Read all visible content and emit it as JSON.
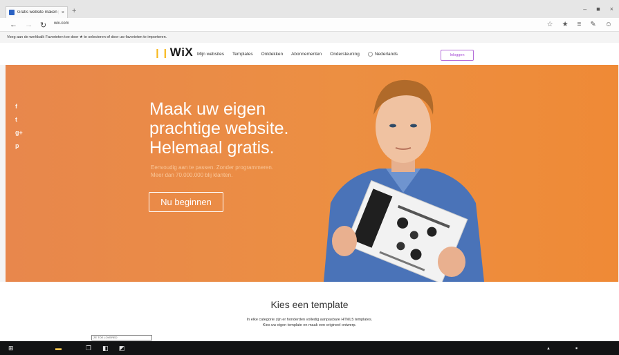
{
  "browser": {
    "tab_title": "Gratis website maken | W",
    "tab_close": "×",
    "new_tab": "+",
    "window_controls": [
      "–",
      "■",
      "×"
    ],
    "back": "←",
    "forward": "→",
    "refresh": "↻",
    "url": "wix.com",
    "right_icons": [
      "☆",
      "★",
      "≡",
      "✎",
      "☺"
    ],
    "favorites_hint": "Voeg aan de werkbalk Favorieten toe door ★ te selecteren of door uw favorieten te importeren."
  },
  "header": {
    "logo": "WiX",
    "logo_mark": "❙❙",
    "nav": [
      "Mijn websites",
      "Templates",
      "Ontdekken",
      "Abonnementen",
      "Ondersteuning"
    ],
    "language": "Nederlands",
    "login": "Inloggen"
  },
  "hero": {
    "social": [
      "f",
      "t",
      "g+",
      "p"
    ],
    "title_lines": [
      "Maak uw eigen",
      "prachtige website.",
      "Helemaal gratis."
    ],
    "subtitle_lines": [
      "Eenvoudig aan te passen. Zonder programmeren.",
      "Meer dan 70.000.000 blij klanten."
    ],
    "cta": "Nu beginnen"
  },
  "section": {
    "title": "Kies een template",
    "desc_lines": [
      "In elke categorie zijn er honderden volledig aanpasbare HTML5 templates.",
      "Kies uw eigen template en maak een origineel ontwerp."
    ],
    "small_label": "ZE TOE LOVERED"
  },
  "taskbar": {
    "start": "⊞",
    "folder": "▬",
    "app1": "❐",
    "app2": "◧",
    "app3": "◩",
    "tray": "▲",
    "tray2": "▪"
  },
  "colors": {
    "hero_orange": "#ec8f42",
    "login_purple": "#a64ad6",
    "taskbar": "#121314"
  }
}
